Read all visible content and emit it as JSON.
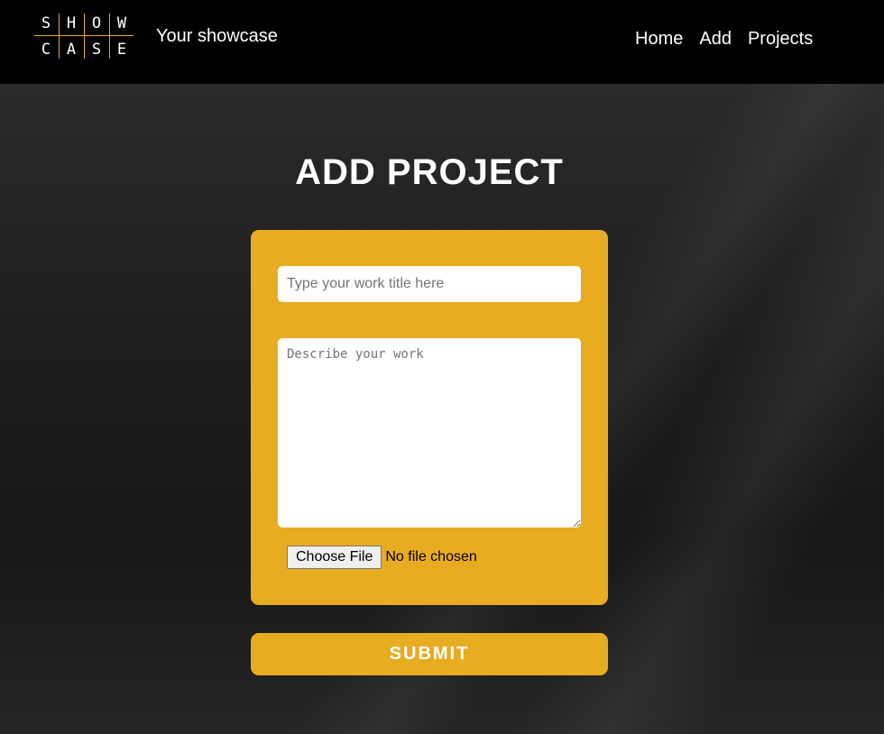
{
  "header": {
    "logo": {
      "row1": [
        "S",
        "H",
        "O",
        "W"
      ],
      "row2": [
        "C",
        "A",
        "S",
        "E"
      ],
      "accent_color": "#e8ac22"
    },
    "tagline": "Your showcase",
    "nav": {
      "home": "Home",
      "add": "Add",
      "projects": "Projects"
    }
  },
  "main": {
    "title": "ADD PROJECT",
    "form": {
      "title_placeholder": "Type your work title here",
      "title_value": "",
      "description_placeholder": "Describe your work",
      "description_value": "",
      "file_button_label": "Choose File",
      "file_status": "No file chosen",
      "card_color": "#e8ac22"
    },
    "submit_label": "SUBMIT"
  }
}
